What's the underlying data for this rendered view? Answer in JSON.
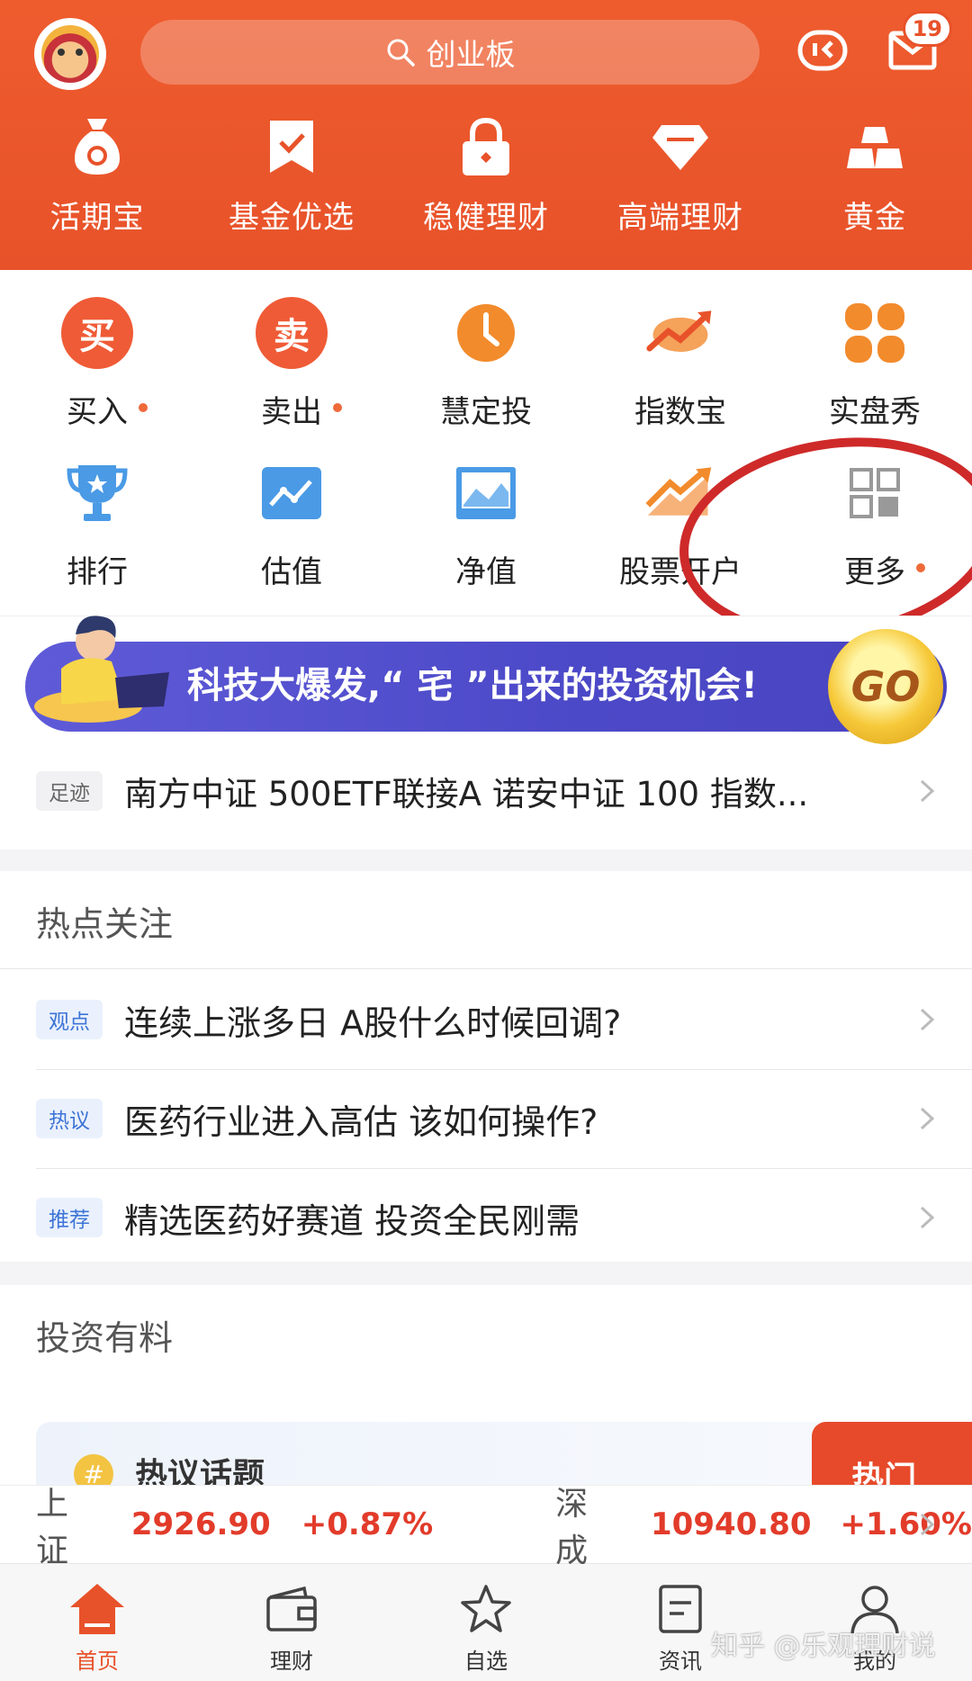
{
  "header": {
    "search_placeholder": "创业板",
    "mail_badge": "19",
    "nav": [
      {
        "label": "活期宝",
        "icon": "money-bag-icon"
      },
      {
        "label": "基金优选",
        "icon": "bookmark-check-icon"
      },
      {
        "label": "稳健理财",
        "icon": "lock-icon"
      },
      {
        "label": "高端理财",
        "icon": "diamond-icon"
      },
      {
        "label": "黄金",
        "icon": "gold-bars-icon"
      }
    ]
  },
  "grid": {
    "row1": [
      {
        "label": "买入",
        "icon_text": "买",
        "dot": true
      },
      {
        "label": "卖出",
        "icon_text": "卖",
        "dot": true
      },
      {
        "label": "慧定投",
        "icon": "clock-icon"
      },
      {
        "label": "指数宝",
        "icon": "trend-arrow-icon"
      },
      {
        "label": "实盘秀",
        "icon": "clover-icon"
      }
    ],
    "row2": [
      {
        "label": "排行",
        "icon": "trophy-icon"
      },
      {
        "label": "估值",
        "icon": "chart-icon"
      },
      {
        "label": "净值",
        "icon": "image-chart-icon"
      },
      {
        "label": "股票开户",
        "icon": "stock-trend-icon"
      },
      {
        "label": "更多",
        "icon": "grid-more-icon",
        "dot": true
      }
    ]
  },
  "banner": {
    "text": "科技大爆发,“ 宅 ”出来的投资机会!",
    "go": "GO"
  },
  "footprint": {
    "tag": "足迹",
    "text": "南方中证 500ETF联接A  诺安中证 100 指数..."
  },
  "hot": {
    "title": "热点关注",
    "items": [
      {
        "tag": "观点",
        "text": "连续上涨多日 A股什么时候回调?"
      },
      {
        "tag": "热议",
        "text": "医药行业进入高估 该如何操作?"
      },
      {
        "tag": "推荐",
        "text": "精选医药好赛道 投资全民刚需"
      }
    ]
  },
  "invest": {
    "title": "投资有料",
    "card_hash": "#",
    "card_title": "热议话题",
    "hot_label": "热门"
  },
  "ticker": {
    "sh_name": "上证",
    "sh_value": "2926.90",
    "sh_change": "+0.87%",
    "sz_name": "深成",
    "sz_value": "10940.80",
    "sz_change": "+1.60%"
  },
  "tabbar": [
    {
      "label": "首页",
      "active": true
    },
    {
      "label": "理财"
    },
    {
      "label": "自选"
    },
    {
      "label": "资讯"
    },
    {
      "label": "我的"
    }
  ],
  "watermark": "知乎 @乐观理财说",
  "colors": {
    "brand": "#e8522a",
    "up": "#e23b2a",
    "annotation": "#cf2a2a"
  }
}
